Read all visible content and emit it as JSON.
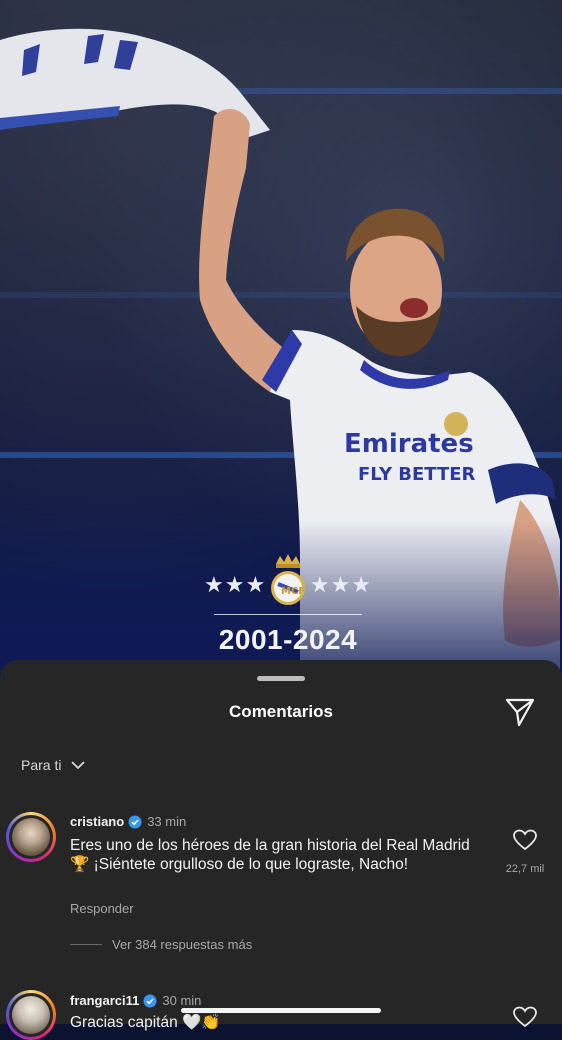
{
  "post": {
    "stars_left": "★★★",
    "stars_right": "★★★",
    "years": "2001-2024",
    "colors": {
      "background": "#141b3d",
      "overlay": "#0f1a55"
    }
  },
  "sheet": {
    "title": "Comentarios",
    "filter_label": "Para ti",
    "send_icon": "send-icon",
    "colors": {
      "background": "#262626",
      "muted": "#a8a8a8"
    }
  },
  "comments": [
    {
      "username": "cristiano",
      "time": "33 min",
      "text": "Eres uno de los héroes de la gran historia del Real Madrid 🏆 ¡Siéntete orgulloso de lo que lograste, Nacho!",
      "reply_label": "Responder",
      "more_replies": "Ver 384 respuestas más",
      "likes": "22,7 mil"
    },
    {
      "username": "frangarci11",
      "time": "30 min",
      "text": "Gracias capitán 🤍👏"
    }
  ]
}
